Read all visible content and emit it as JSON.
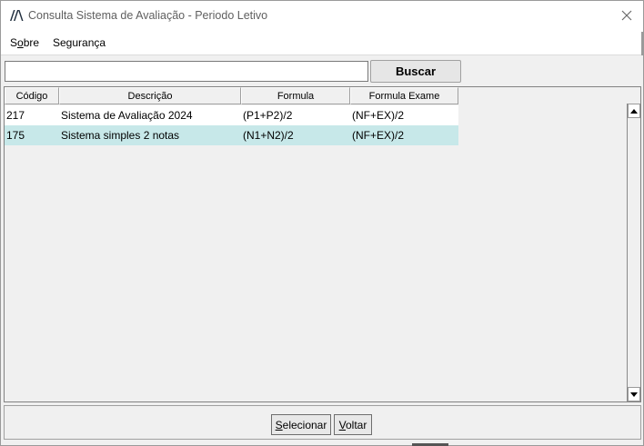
{
  "window": {
    "title": "Consulta Sistema de Avaliação - Periodo Letivo",
    "logo_icon": "app-logo-icon",
    "close_icon": "close-icon"
  },
  "menu": {
    "items": [
      {
        "label": "Sobre",
        "underline_index": 1
      },
      {
        "label": "Segurança",
        "underline_index": -1
      }
    ]
  },
  "search": {
    "value": "",
    "button_label": "Buscar"
  },
  "table": {
    "columns": [
      "Código",
      "Descrição",
      "Formula",
      "Formula Exame"
    ],
    "rows": [
      {
        "codigo": "217",
        "descricao": "Sistema de Avaliação 2024",
        "formula": "(P1+P2)/2",
        "formula_exame": "(NF+EX)/2",
        "selected": false
      },
      {
        "codigo": "175",
        "descricao": "Sistema simples 2 notas",
        "formula": "(N1+N2)/2",
        "formula_exame": "(NF+EX)/2",
        "selected": true
      }
    ]
  },
  "buttons": {
    "selecionar": "Selecionar",
    "voltar": "Voltar"
  },
  "colors": {
    "selected_row": "#c7e8e9",
    "title_text": "#5f5f5f"
  }
}
